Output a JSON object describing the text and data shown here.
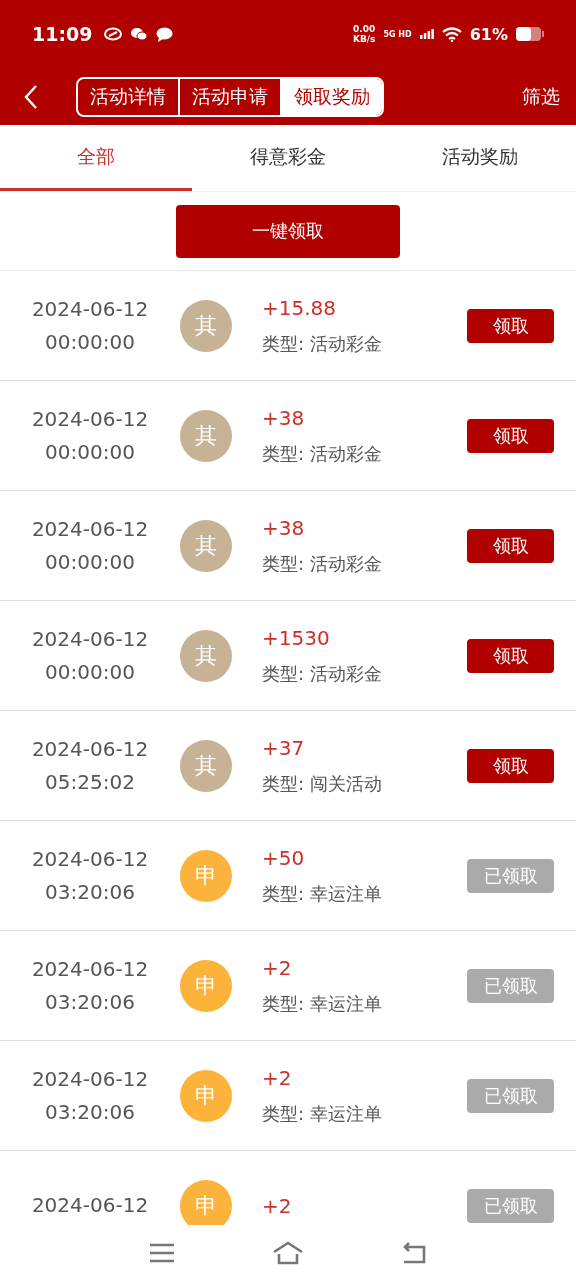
{
  "status_bar": {
    "time": "11:09",
    "net_speed": "0.00",
    "net_unit": "KB/s",
    "network": "5G HD",
    "battery": "61%"
  },
  "header": {
    "segments": [
      {
        "label": "活动详情",
        "selected": false
      },
      {
        "label": "活动申请",
        "selected": false
      },
      {
        "label": "领取奖励",
        "selected": true
      }
    ],
    "filter": "筛选"
  },
  "tabs": [
    {
      "label": "全部",
      "selected": true
    },
    {
      "label": "得意彩金",
      "selected": false
    },
    {
      "label": "活动奖励",
      "selected": false
    }
  ],
  "claim_all_button": "一键领取",
  "rows": [
    {
      "date": "2024-06-12",
      "time": "00:00:00",
      "kind": "other",
      "avatar": "其",
      "amount": "+15.88",
      "type": "类型: 活动彩金",
      "button": "领取",
      "claimed": false
    },
    {
      "date": "2024-06-12",
      "time": "00:00:00",
      "kind": "other",
      "avatar": "其",
      "amount": "+38",
      "type": "类型: 活动彩金",
      "button": "领取",
      "claimed": false
    },
    {
      "date": "2024-06-12",
      "time": "00:00:00",
      "kind": "other",
      "avatar": "其",
      "amount": "+38",
      "type": "类型: 活动彩金",
      "button": "领取",
      "claimed": false
    },
    {
      "date": "2024-06-12",
      "time": "00:00:00",
      "kind": "other",
      "avatar": "其",
      "amount": "+1530",
      "type": "类型: 活动彩金",
      "button": "领取",
      "claimed": false
    },
    {
      "date": "2024-06-12",
      "time": "05:25:02",
      "kind": "other",
      "avatar": "其",
      "amount": "+37",
      "type": "类型: 闯关活动",
      "button": "领取",
      "claimed": false
    },
    {
      "date": "2024-06-12",
      "time": "03:20:06",
      "kind": "apply",
      "avatar": "申",
      "amount": "+50",
      "type": "类型: 幸运注单",
      "button": "已领取",
      "claimed": true
    },
    {
      "date": "2024-06-12",
      "time": "03:20:06",
      "kind": "apply",
      "avatar": "申",
      "amount": "+2",
      "type": "类型: 幸运注单",
      "button": "已领取",
      "claimed": true
    },
    {
      "date": "2024-06-12",
      "time": "03:20:06",
      "kind": "apply",
      "avatar": "申",
      "amount": "+2",
      "type": "类型: 幸运注单",
      "button": "已领取",
      "claimed": true
    },
    {
      "date": "2024-06-12",
      "kind": "apply",
      "avatar": "申",
      "amount": "+2",
      "button": "已领取",
      "claimed": true
    }
  ]
}
